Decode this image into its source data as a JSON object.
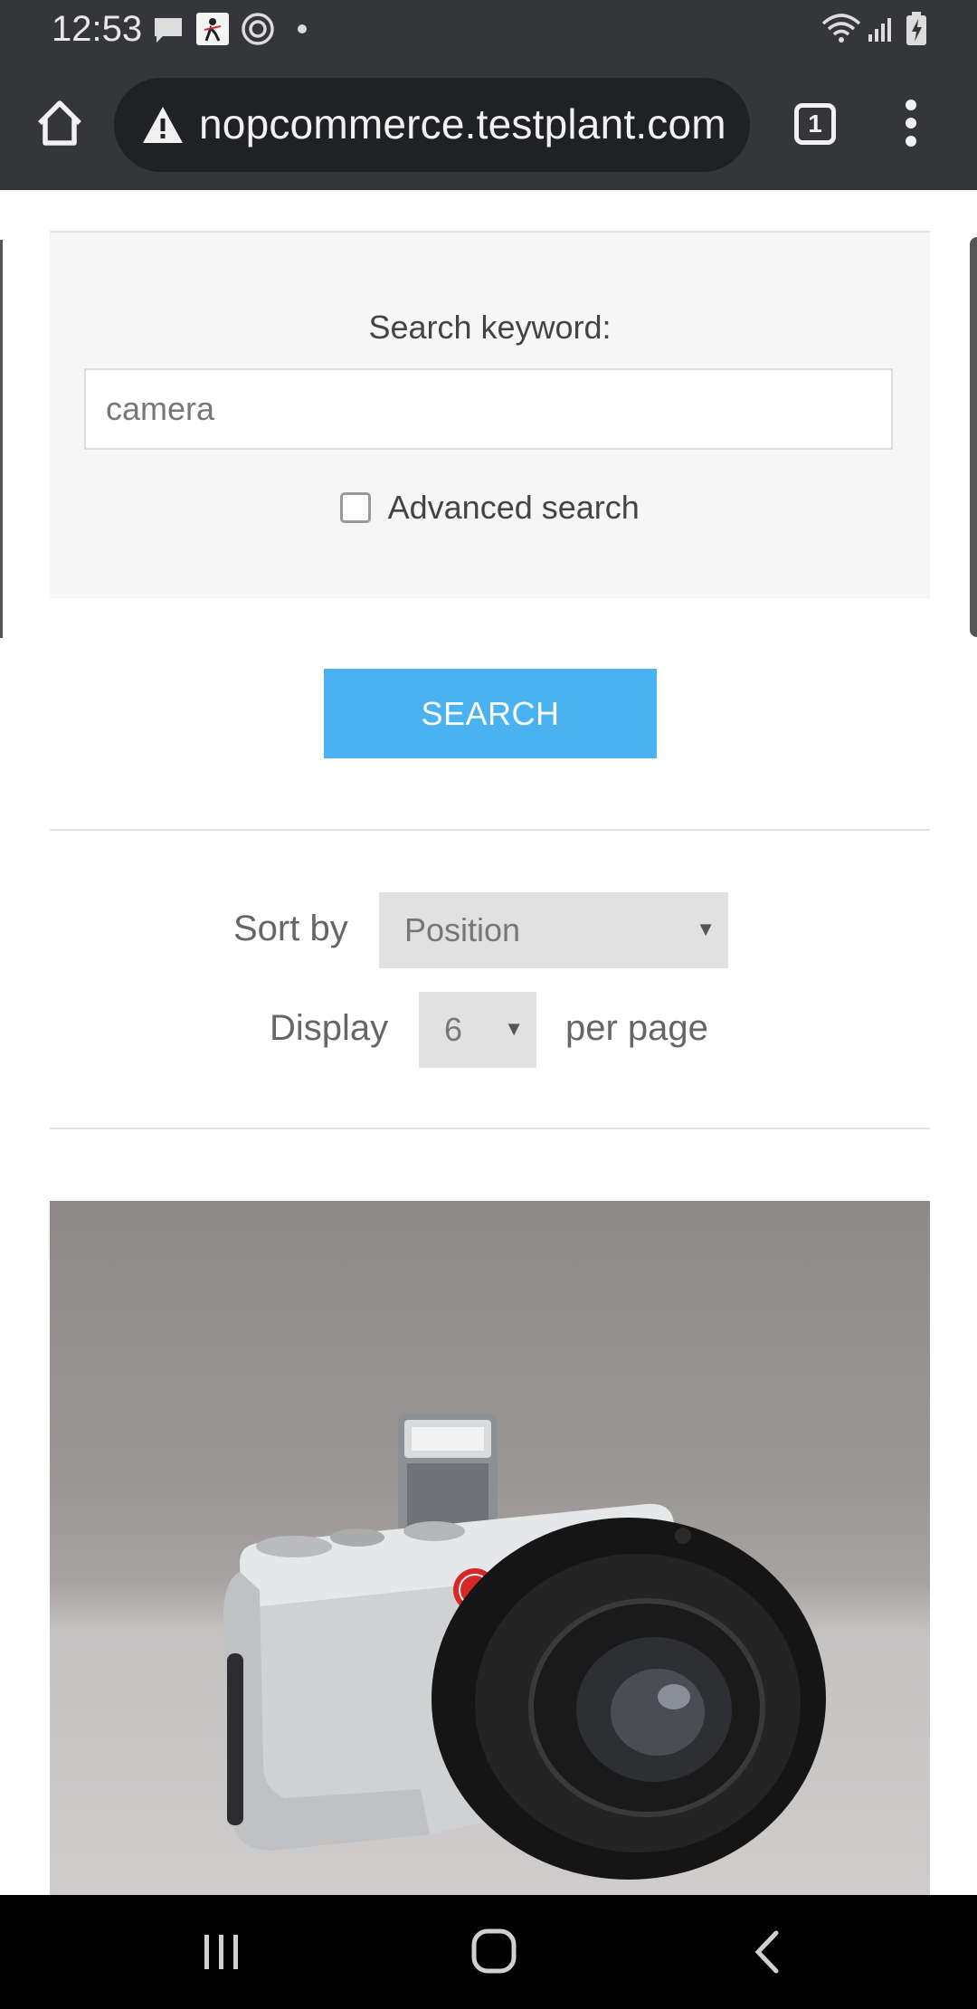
{
  "status_bar": {
    "time": "12:53",
    "left_icons": [
      "chat-bubble-icon",
      "game-app-icon",
      "at-sign-icon",
      "dot-icon"
    ],
    "right_icons": [
      "wifi-icon",
      "signal-icon",
      "battery-charging-icon"
    ]
  },
  "browser": {
    "url": "nopcommerce.testplant.com",
    "tab_count": "1",
    "icons": [
      "home-icon",
      "warning-icon",
      "tabs-icon",
      "more-vert-icon"
    ]
  },
  "search_form": {
    "keyword_label": "Search keyword:",
    "keyword_value": "camera",
    "advanced_search_label": "Advanced search",
    "advanced_search_checked": false,
    "search_button_label": "SEARCH"
  },
  "results_controls": {
    "sort_by_label": "Sort by",
    "sort_by_value": "Position",
    "display_label": "Display",
    "display_value": "6",
    "per_page_label": "per page"
  },
  "product": {
    "image_subject": "silver mirrorless camera"
  },
  "nav_bar": {
    "icons": [
      "recent-apps-icon",
      "home-circle-icon",
      "back-icon"
    ]
  },
  "colors": {
    "chrome_bar": "#35363a",
    "url_pill": "#202124",
    "search_button": "#4ab2f1",
    "panel_bg": "#f6f6f6",
    "select_bg": "#e1e1e1"
  }
}
